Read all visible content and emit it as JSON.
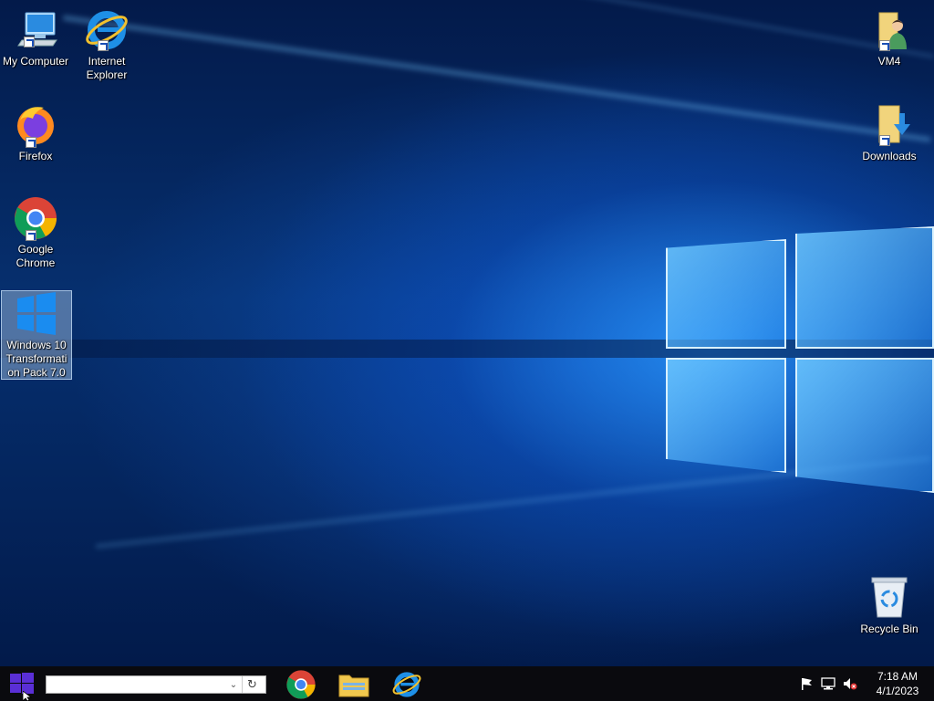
{
  "desktop": {
    "icons": [
      {
        "id": "my-computer",
        "label": "My Computer"
      },
      {
        "id": "internet-explorer",
        "label": "Internet Explorer"
      },
      {
        "id": "firefox",
        "label": "Firefox"
      },
      {
        "id": "google-chrome",
        "label": "Google Chrome"
      },
      {
        "id": "win10-transformation-pack",
        "label": "Windows 10 Transformation Pack 7.0"
      },
      {
        "id": "vm4",
        "label": "VM4"
      },
      {
        "id": "downloads",
        "label": "Downloads"
      },
      {
        "id": "recycle-bin",
        "label": "Recycle Bin"
      }
    ]
  },
  "taskbar": {
    "start_icon": "windows-logo-icon",
    "search": {
      "value": "",
      "placeholder": ""
    },
    "pinned": [
      {
        "id": "chrome",
        "icon": "chrome-icon"
      },
      {
        "id": "file-explorer",
        "icon": "folder-icon"
      },
      {
        "id": "internet-explorer",
        "icon": "ie-icon"
      }
    ],
    "tray": {
      "icons": [
        "flag-icon",
        "network-icon",
        "volume-muted-icon"
      ],
      "time": "7:18 AM",
      "date": "4/1/2023"
    }
  },
  "colors": {
    "accent": "#1e90ff",
    "taskbar": "#0a0a0e",
    "start": "#5a2fd6"
  }
}
